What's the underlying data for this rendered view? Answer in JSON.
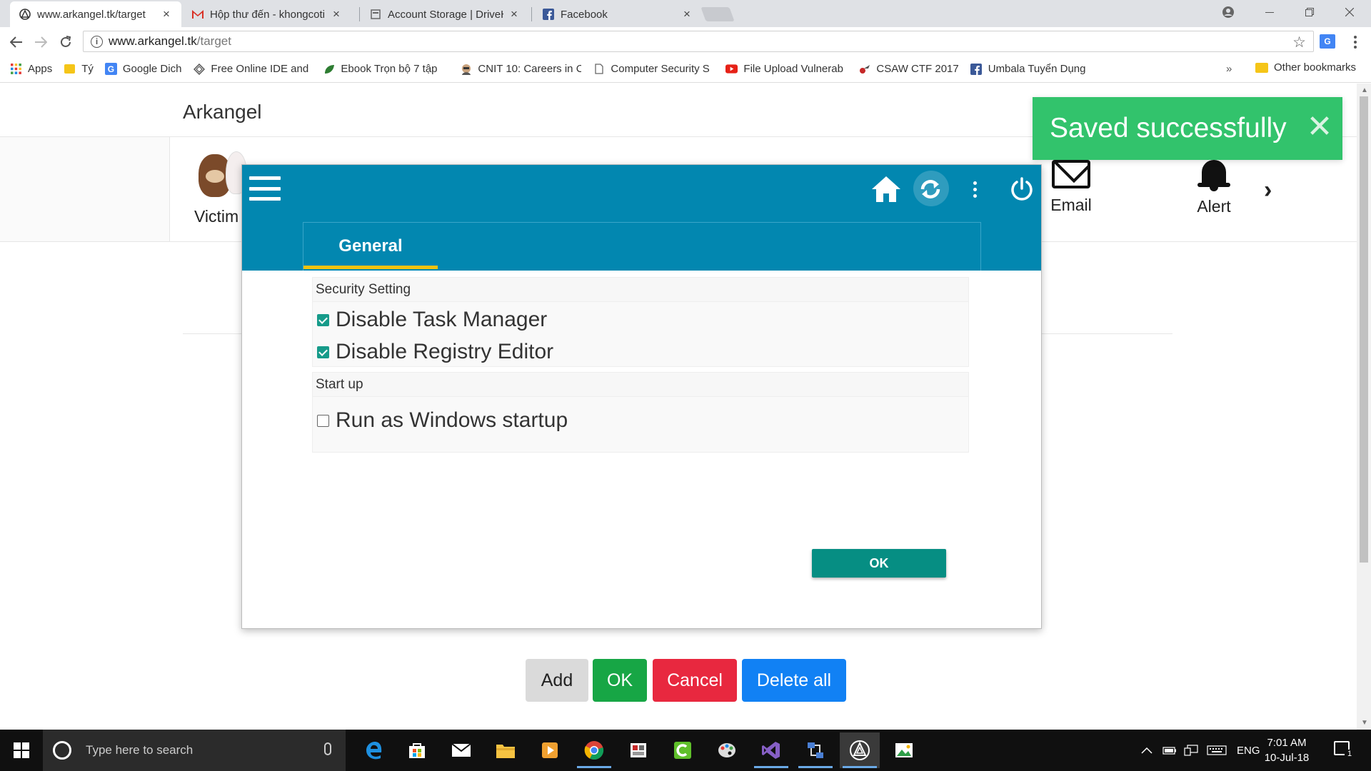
{
  "browser": {
    "tabs": [
      {
        "title": "www.arkangel.tk/target",
        "icon": "arkangel-icon",
        "active": true
      },
      {
        "title": "Hộp thư đến - khongcoti",
        "icon": "gmail-icon",
        "active": false
      },
      {
        "title": "Account Storage | DriveH",
        "icon": "page-icon",
        "active": false
      },
      {
        "title": "Facebook",
        "icon": "facebook-icon",
        "active": false
      }
    ],
    "url_host": "www.arkangel.tk",
    "url_path": "/target",
    "bookmarks": [
      {
        "label": "Apps",
        "icon": "apps-grid-icon"
      },
      {
        "label": "Tý",
        "icon": "folder-icon"
      },
      {
        "label": "Google Dich",
        "icon": "translate-icon"
      },
      {
        "label": "Free Online IDE and",
        "icon": "ide-icon"
      },
      {
        "label": "Ebook Trọn bộ 7 tập",
        "icon": "leaf-icon"
      },
      {
        "label": "CNIT 10: Careers in C",
        "icon": "avatar-icon"
      },
      {
        "label": "Computer Security S",
        "icon": "page-icon"
      },
      {
        "label": "File Upload Vulnerab",
        "icon": "youtube-icon"
      },
      {
        "label": "CSAW CTF 2017",
        "icon": "ctf-icon"
      },
      {
        "label": "Umbala Tuyển Dụng",
        "icon": "facebook-icon"
      }
    ],
    "bookmarks_overflow": "»",
    "other_bookmarks": "Other bookmarks"
  },
  "page": {
    "brand": "Arkangel",
    "nav": {
      "victim_label": "Victim",
      "email_label": "Email",
      "alert_label": "Alert"
    },
    "toast": {
      "message": "Saved successfully",
      "close": "✕"
    },
    "actions": {
      "add": "Add",
      "ok": "OK",
      "cancel": "Cancel",
      "delete_all": "Delete all"
    }
  },
  "dialog": {
    "tab_general": "General",
    "sections": [
      {
        "title": "Security Setting",
        "options": [
          {
            "label": "Disable Task Manager",
            "checked": true
          },
          {
            "label": "Disable Registry Editor",
            "checked": true
          }
        ]
      },
      {
        "title": "Start up",
        "options": [
          {
            "label": "Run as Windows startup",
            "checked": false
          }
        ]
      }
    ],
    "ok_label": "OK"
  },
  "taskbar": {
    "search_placeholder": "Type here to search",
    "language": "ENG",
    "time": "7:01 AM",
    "date": "10-Jul-18",
    "notification_count": "1"
  },
  "colors": {
    "dialog_header": "#0287b0",
    "tab_underline": "#f0c20f",
    "toast": "#32c36c",
    "ok_green": "#17a645",
    "cancel_red": "#e8283f",
    "delete_blue": "#1181f4",
    "checkbox_teal": "#169b8a"
  }
}
